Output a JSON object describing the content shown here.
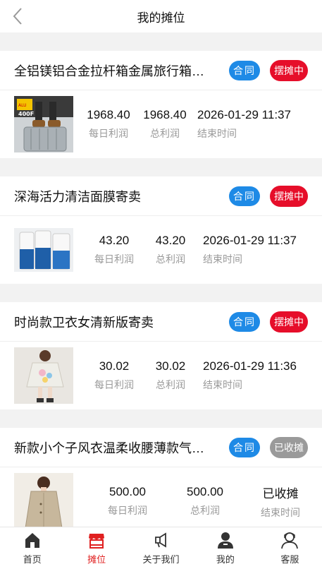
{
  "header": {
    "title": "我的摊位"
  },
  "stalls": [
    {
      "name": "全铝镁铝合金拉杆箱金属旅行箱…",
      "contract": "合同",
      "status": "摆摊中",
      "status_type": "active",
      "daily": "1968.40",
      "total": "1968.40",
      "end": "2026-01-29 11:37",
      "daily_label": "每日利润",
      "total_label": "总利润",
      "end_label": "结束时间",
      "thumb": "suitcase",
      "thumb_text": "400F"
    },
    {
      "name": "深海活力清洁面膜寄卖",
      "contract": "合同",
      "status": "摆摊中",
      "status_type": "active",
      "daily": "43.20",
      "total": "43.20",
      "end": "2026-01-29 11:37",
      "daily_label": "每日利润",
      "total_label": "总利润",
      "end_label": "结束时间",
      "thumb": "mask"
    },
    {
      "name": "时尚款卫衣女清新版寄卖",
      "contract": "合同",
      "status": "摆摊中",
      "status_type": "active",
      "daily": "30.02",
      "total": "30.02",
      "end": "2026-01-29 11:36",
      "daily_label": "每日利润",
      "total_label": "总利润",
      "end_label": "结束时间",
      "thumb": "hoodie"
    },
    {
      "name": "新款小个子风衣温柔收腰薄款气…",
      "contract": "合同",
      "status": "已收摊",
      "status_type": "closed",
      "daily": "500.00",
      "total": "500.00",
      "end": "已收摊",
      "daily_label": "每日利润",
      "total_label": "总利润",
      "end_label": "结束时间",
      "thumb": "coat"
    }
  ],
  "tabbar": {
    "items": [
      {
        "label": "首页",
        "icon": "home-icon"
      },
      {
        "label": "摊位",
        "icon": "stall-icon",
        "active": true
      },
      {
        "label": "关于我们",
        "icon": "megaphone-icon"
      },
      {
        "label": "我的",
        "icon": "user-icon"
      },
      {
        "label": "客服",
        "icon": "support-icon"
      }
    ]
  },
  "colors": {
    "accent": "#e02020",
    "contract": "#1e8ae6",
    "active_badge": "#e60e2a",
    "closed_badge": "#9a9a9a"
  }
}
